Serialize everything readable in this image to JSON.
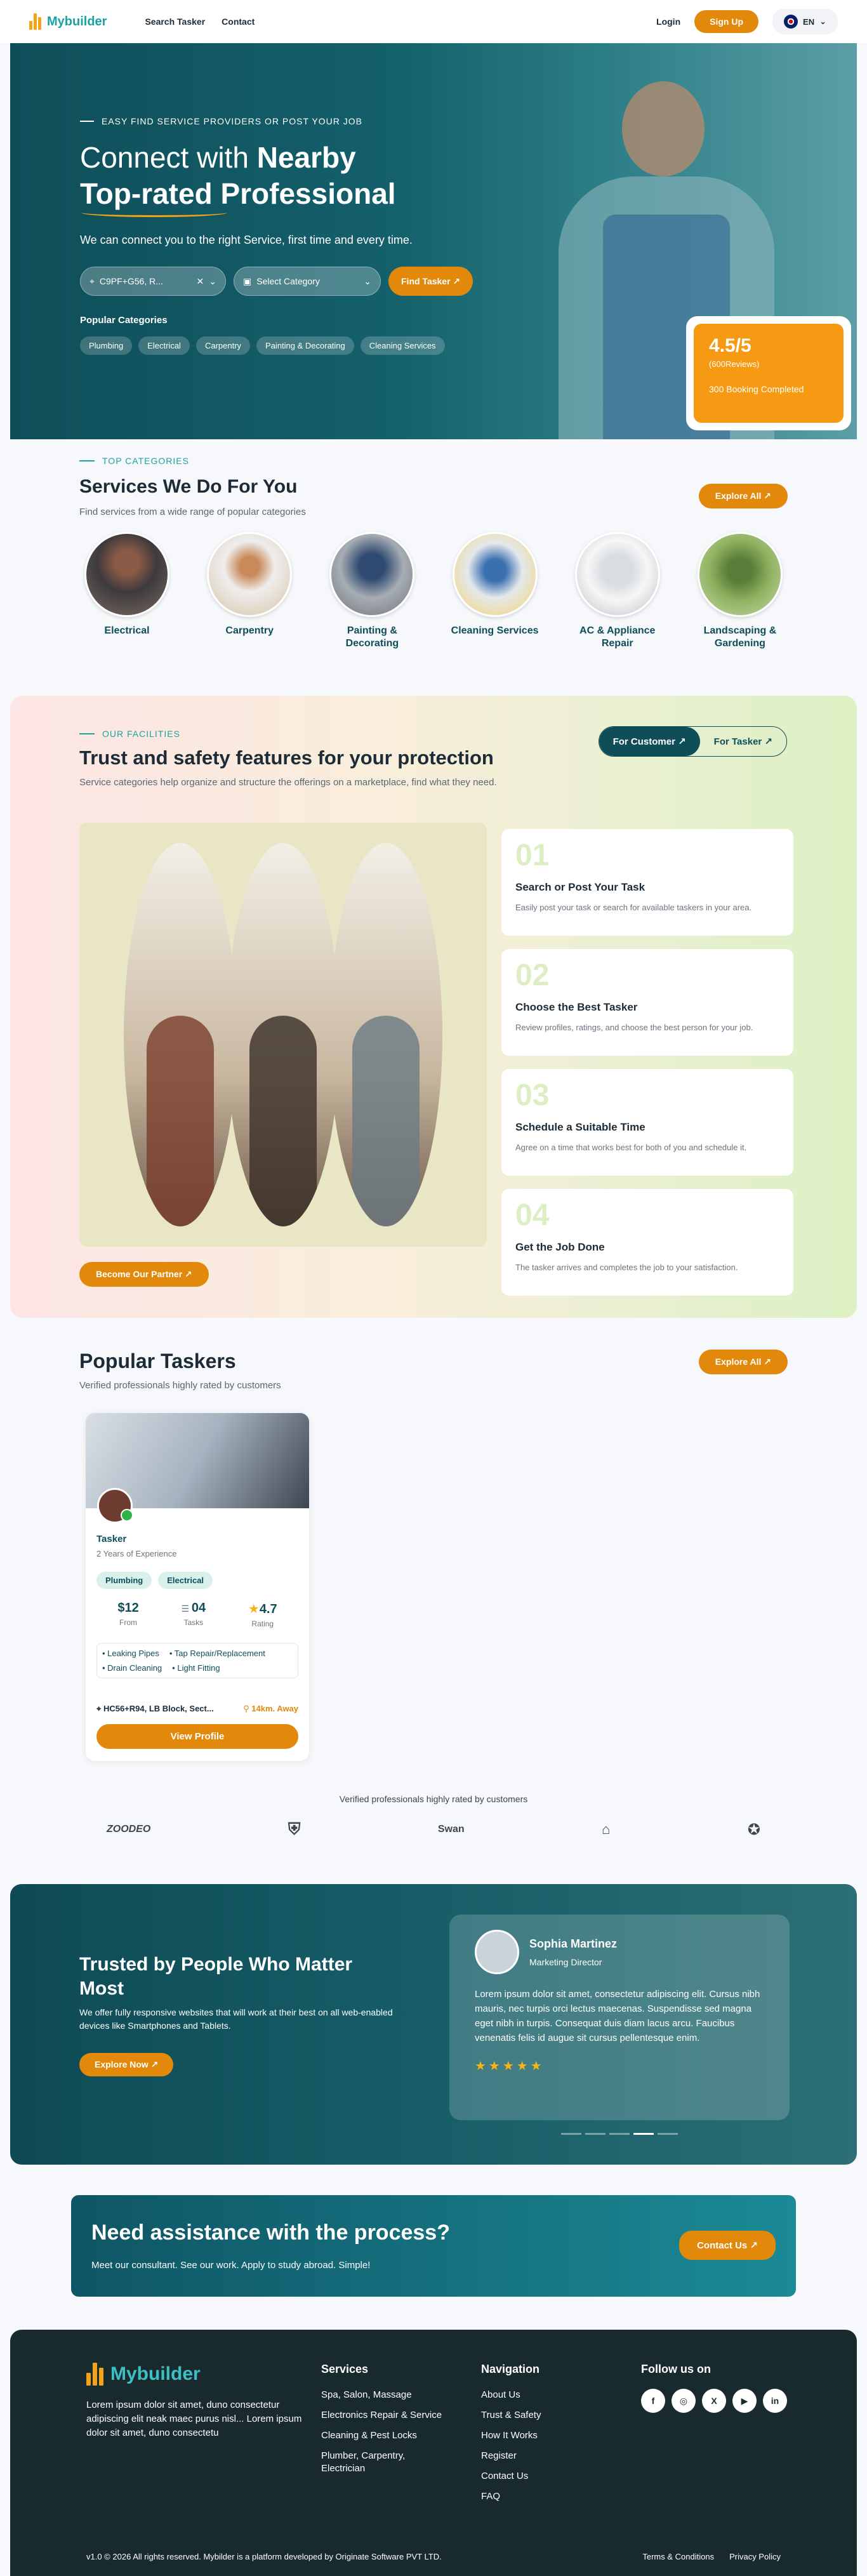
{
  "header": {
    "brand": "Mybuilder",
    "nav": [
      "Search Tasker",
      "Contact"
    ],
    "login": "Login",
    "signup": "Sign Up",
    "lang": "EN"
  },
  "hero": {
    "eyebrow": "EASY FIND SERVICE PROVIDERS OR POST YOUR JOB",
    "title_a": "Connect with ",
    "title_b": "Nearby",
    "title_c": "Top-rated Professional",
    "subtitle": "We can connect you to the right Service, first time and every time.",
    "location_value": "C9PF+G56, R...",
    "category_placeholder": "Select Category",
    "find_btn": "Find Tasker ↗",
    "popular_label": "Popular Categories",
    "chips": [
      "Plumbing",
      "Electrical",
      "Carpentry",
      "Painting & Decorating",
      "Cleaning Services"
    ],
    "rating": "4.5/5",
    "reviews": "(600Reviews)",
    "bookings": "300 Booking Completed"
  },
  "services": {
    "eyebrow": "TOP CATEGORIES",
    "title": "Services We Do For You",
    "desc": "Find services from a wide range of popular categories",
    "explore": "Explore All ↗",
    "items": [
      "Electrical",
      "Carpentry",
      "Painting & Decorating",
      "Cleaning Services",
      "AC & Appliance Repair",
      "Landscaping & Gardening"
    ]
  },
  "trust": {
    "eyebrow": "OUR FACILITIES",
    "title": "Trust and safety features for your protection",
    "desc": "Service categories help organize and structure the offerings on a marketplace, find what they need.",
    "tab_customer": "For Customer ↗",
    "tab_tasker": "For Tasker ↗",
    "partner_btn": "Become Our Partner ↗",
    "steps": [
      {
        "num": "01",
        "title": "Search or Post Your Task",
        "desc": "Easily post your task or search for available taskers in your area."
      },
      {
        "num": "02",
        "title": "Choose the Best Tasker",
        "desc": "Review profiles, ratings, and choose the best person for your job."
      },
      {
        "num": "03",
        "title": "Schedule a Suitable Time",
        "desc": "Agree on a time that works best for both of you and schedule it."
      },
      {
        "num": "04",
        "title": "Get the Job Done",
        "desc": "The tasker arrives and completes the job to your satisfaction."
      }
    ]
  },
  "taskers": {
    "title": "Popular Taskers",
    "desc": "Verified professionals highly rated by customers",
    "explore": "Explore All ↗",
    "card": {
      "name": "Tasker",
      "experience": "2 Years of Experience",
      "chips": [
        "Plumbing",
        "Electrical"
      ],
      "price": "$12",
      "price_label": "From",
      "tasks": "04",
      "tasks_label": "Tasks",
      "rating": "4.7",
      "rating_label": "Rating",
      "skills": [
        "Leaking Pipes",
        "Tap Repair/Replacement",
        "Drain Cleaning",
        "Light Fitting"
      ],
      "location": "HC56+R94, LB Block, Sect...",
      "distance": "14km. Away",
      "button": "View Profile"
    }
  },
  "brands": {
    "caption": "Verified professionals highly rated by customers",
    "names": [
      "ZOODEO",
      "Shield",
      "Swan",
      "Palm",
      "Badge"
    ]
  },
  "testimonial": {
    "title": "Trusted by People Who Matter Most",
    "desc": "We offer fully responsive websites that will work at their best on all web-enabled devices like Smartphones and Tablets.",
    "button": "Explore Now ↗",
    "name": "Sophia Martinez",
    "role": "Marketing Director",
    "quote": "Lorem ipsum dolor sit amet, consectetur adipiscing elit. Cursus nibh mauris, nec turpis orci lectus maecenas. Suspendisse sed magna eget nibh in turpis. Consequat duis diam lacus arcu. Faucibus venenatis felis id augue sit cursus pellentesque enim.",
    "stars": "★★★★★"
  },
  "help": {
    "title": "Need assistance with the process?",
    "desc": "Meet our consultant. See our work. Apply to study abroad. Simple!",
    "button": "Contact Us ↗"
  },
  "footer": {
    "brand": "Mybuilder",
    "desc": "Lorem ipsum dolor sit amet, duno consectetur adipiscing elit neak maec purus nisl... Lorem ipsum dolor sit amet, duno consectetu",
    "services_title": "Services",
    "services": [
      "Spa, Salon, Massage",
      "Electronics Repair & Service",
      "Cleaning & Pest Locks",
      "Plumber, Carpentry, Electrician"
    ],
    "nav_title": "Navigation",
    "nav": [
      "About Us",
      "Trust & Safety",
      "How It Works",
      "Register",
      "Contact Us",
      "FAQ"
    ],
    "follow_title": "Follow us on",
    "social": [
      "f",
      "◎",
      "X",
      "▶",
      "in"
    ],
    "copyright": "v1.0 © 2026 All rights reserved. Mybilder is a platform developed by Originate Software PVT LTD.",
    "terms": "Terms & Conditions",
    "privacy": "Privacy Policy"
  },
  "colors": {
    "accent": "#e2880a",
    "primary": "#0f4e59",
    "teal": "#1aa3a3"
  }
}
